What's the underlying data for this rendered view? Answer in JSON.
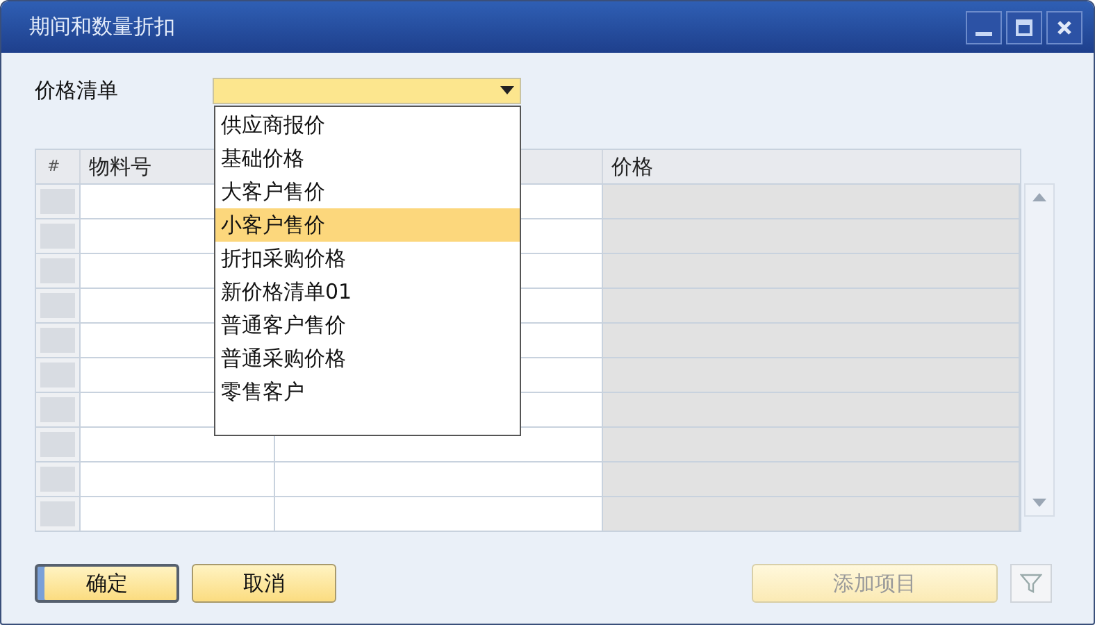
{
  "window": {
    "title": "期间和数量折扣"
  },
  "price_list": {
    "label": "价格清单",
    "expanded": true,
    "options": [
      {
        "label": "供应商报价",
        "selected": false
      },
      {
        "label": "基础价格",
        "selected": false
      },
      {
        "label": "大客户售价",
        "selected": false
      },
      {
        "label": "小客户售价",
        "selected": true
      },
      {
        "label": "折扣采购价格",
        "selected": false
      },
      {
        "label": "新价格清单01",
        "selected": false
      },
      {
        "label": "普通客户售价",
        "selected": false
      },
      {
        "label": "普通采购价格",
        "selected": false
      },
      {
        "label": "零售客户",
        "selected": false
      }
    ]
  },
  "table": {
    "columns": [
      "#",
      "物料号",
      "价格"
    ],
    "rows": [
      {
        "kind": "blank"
      },
      {
        "kind": "blank"
      },
      {
        "kind": "blank"
      },
      {
        "kind": "blank"
      },
      {
        "kind": "blank"
      },
      {
        "kind": "blank"
      },
      {
        "kind": "blank"
      },
      {
        "kind": "blank"
      },
      {
        "kind": "blank"
      },
      {
        "kind": "blank"
      }
    ]
  },
  "buttons": [
    {
      "label": "确定",
      "focused": true,
      "disabled": false
    },
    {
      "label": "取消",
      "focused": false,
      "disabled": false
    },
    {
      "label": "添加项目",
      "focused": false,
      "disabled": true
    }
  ]
}
